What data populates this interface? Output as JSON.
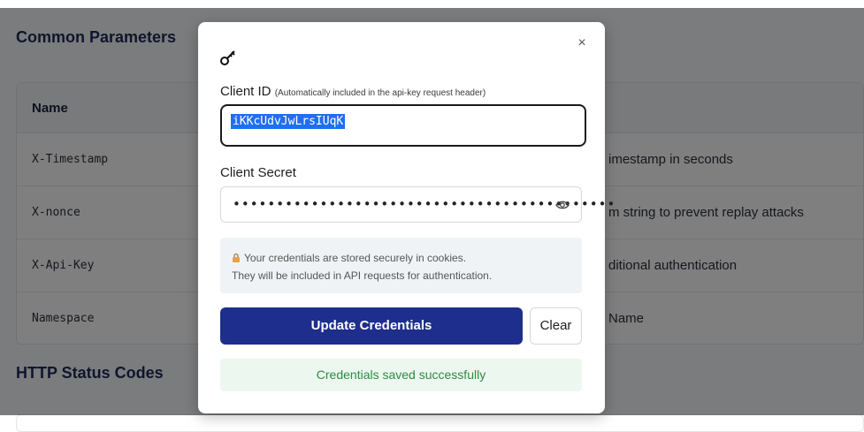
{
  "background": {
    "common_parameters": {
      "title": "Common Parameters",
      "header_name": "Name",
      "rows": [
        {
          "name": "X-Timestamp",
          "description": "imestamp in seconds"
        },
        {
          "name": "X-nonce",
          "description": "m string to prevent replay attacks"
        },
        {
          "name": "X-Api-Key",
          "description": "ditional authentication"
        },
        {
          "name": "Namespace",
          "description": "Name"
        }
      ]
    },
    "http_status_codes": {
      "title": "HTTP Status Codes"
    }
  },
  "modal": {
    "close_label": "×",
    "client_id": {
      "label": "Client ID",
      "hint": "(Automatically included in the api-key request header)",
      "value": "iKKcUdvJwLrsIUqK"
    },
    "client_secret": {
      "label": "Client Secret",
      "masked_value": "••••••••••••••••••••••••••••••••••••••••••••"
    },
    "notice": {
      "line1": "Your credentials are stored securely in cookies.",
      "line2": "They will be included in API requests for authentication."
    },
    "update_button": "Update Credentials",
    "clear_button": "Clear",
    "success_message": "Credentials saved successfully"
  },
  "colors": {
    "primary_button": "#1e2e8c",
    "success_text": "#2d8a45",
    "success_bg": "#ecf8ef",
    "selection": "#1f6ff0"
  },
  "icons": [
    "key-icon",
    "close-icon",
    "eye-icon",
    "lock-icon"
  ]
}
